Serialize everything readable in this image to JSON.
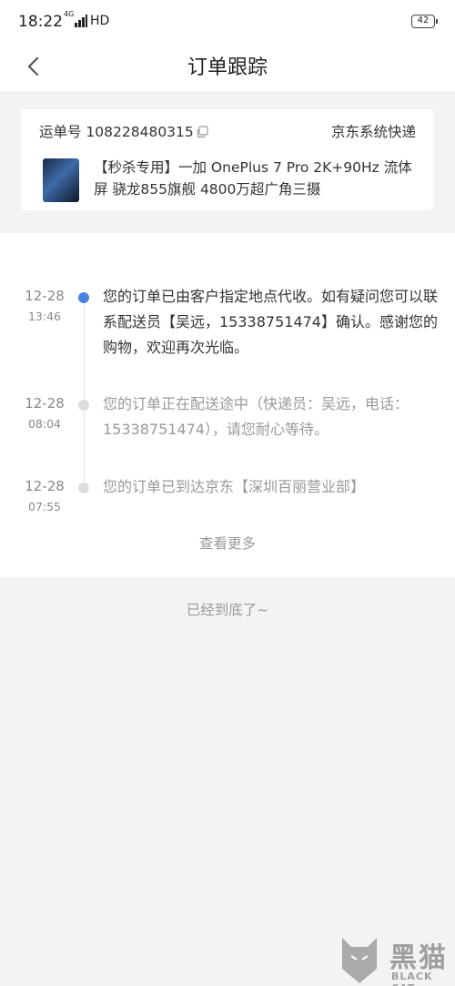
{
  "status_bar": {
    "time": "18:22",
    "network": "4G",
    "hd": "HD",
    "battery": "42"
  },
  "header": {
    "title": "订单跟踪",
    "back_icon": "chevron-left-icon"
  },
  "order": {
    "waybill_label": "运单号 108228480315",
    "carrier": "京东系统快递",
    "product_title": "【秒杀专用】一加 OnePlus 7 Pro 2K+90Hz 流体屏 骁龙855旗舰 4800万超广角三摄",
    "copy_icon": "copy-icon"
  },
  "events": [
    {
      "date": "12-28",
      "time": "13:46",
      "text": "您的订单已由客户指定地点代收。如有疑问您可以联系配送员【吴远，15338751474】确认。感谢您的购物，欢迎再次光临。",
      "active": true
    },
    {
      "date": "12-28",
      "time": "08:04",
      "text": "您的订单正在配送途中（快递员：吴远，电话：15338751474），请您耐心等待。",
      "active": false
    },
    {
      "date": "12-28",
      "time": "07:55",
      "text": "您的订单已到达京东【深圳百丽营业部】",
      "active": false
    }
  ],
  "view_more": "查看更多",
  "bottom_text": "已经到底了~",
  "watermark": {
    "cn": "黑猫",
    "en": "BLACK CAT"
  },
  "colors": {
    "accent_dot": "#4a82e3",
    "page_bg": "#f2f4f4"
  }
}
